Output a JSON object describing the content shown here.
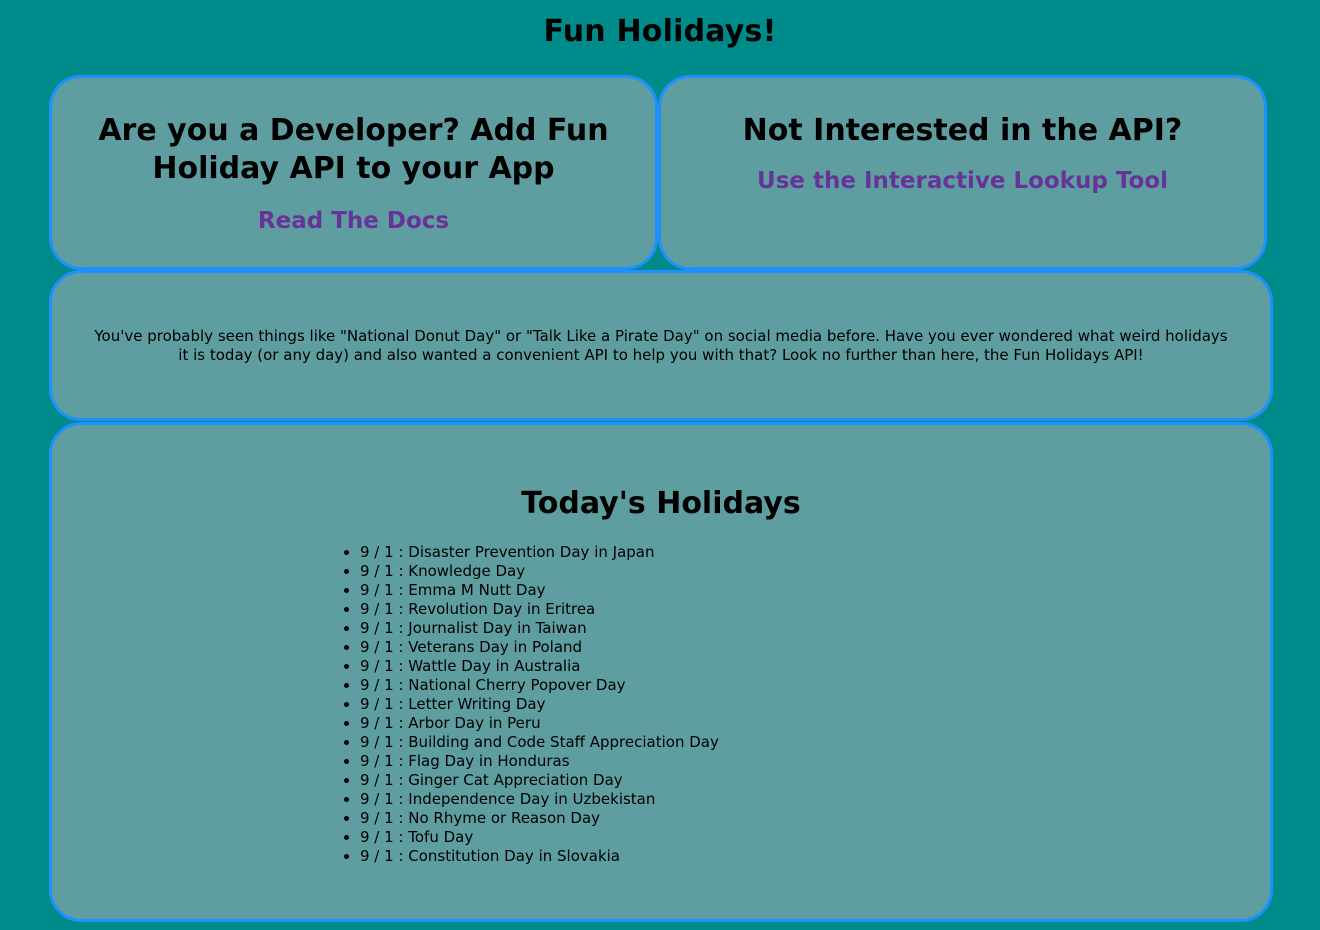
{
  "header": {
    "title": "Fun Holidays!"
  },
  "developer_card": {
    "heading": "Are you a Developer? Add Fun Holiday API to your App",
    "link_label": "Read The Docs"
  },
  "tool_card": {
    "heading": "Not Interested in the API?",
    "link_label": "Use the Interactive Lookup Tool"
  },
  "about": {
    "text": "You've probably seen things like \"National Donut Day\" or \"Talk Like a Pirate Day\" on social media before. Have you ever wondered what weird holidays it is today (or any day) and also wanted a convenient API to help you with that? Look no further than here, the Fun Holidays API!"
  },
  "holidays": {
    "heading": "Today's Holidays",
    "items": [
      "9 / 1 : Disaster Prevention Day in Japan",
      "9 / 1 : Knowledge Day",
      "9 / 1 : Emma M Nutt Day",
      "9 / 1 : Revolution Day in Eritrea",
      "9 / 1 : Journalist Day in Taiwan",
      "9 / 1 : Veterans Day in Poland",
      "9 / 1 : Wattle Day in Australia",
      "9 / 1 : National Cherry Popover Day",
      "9 / 1 : Letter Writing Day",
      "9 / 1 : Arbor Day in Peru",
      "9 / 1 : Building and Code Staff Appreciation Day",
      "9 / 1 : Flag Day in Honduras",
      "9 / 1 : Ginger Cat Appreciation Day",
      "9 / 1 : Independence Day in Uzbekistan",
      "9 / 1 : No Rhyme or Reason Day",
      "9 / 1 : Tofu Day",
      "9 / 1 : Constitution Day in Slovakia"
    ]
  },
  "colors": {
    "page_background": "#008b8b",
    "card_background": "#5f9ea0",
    "card_border": "#1e90ff",
    "link": "#663399"
  }
}
